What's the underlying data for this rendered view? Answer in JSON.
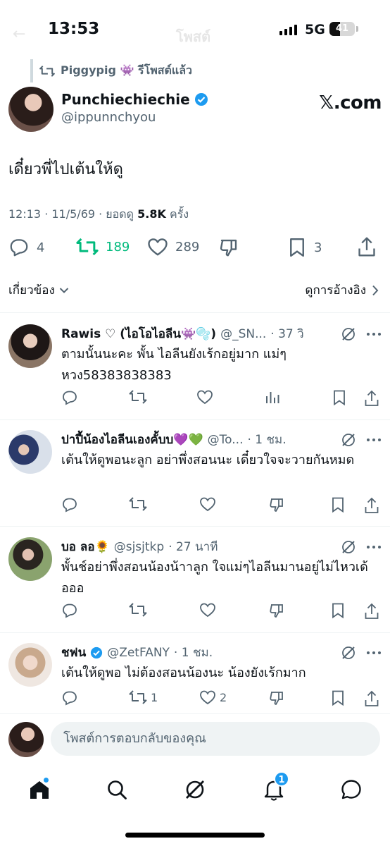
{
  "status": {
    "time": "13:53",
    "network": "5G",
    "battery": "41",
    "battery_fraction": 0.41,
    "faded_title": "โพสต์",
    "faded_back": "←"
  },
  "repost_banner": {
    "text": "Piggypig 👾 รีโพสต์แล้ว"
  },
  "author": {
    "name": "Punchiechiechie",
    "handle": "@ippunnchyou",
    "verified": true,
    "watermark": "𝕏.com"
  },
  "post": {
    "text": "เดี๋ยวพี่ไปเต้นให้ดู",
    "meta_prefix": "12:13 · 11/5/69 · ยอดดู ",
    "views": "5.8K",
    "meta_suffix": " ครั้ง"
  },
  "post_actions": {
    "replies": "4",
    "reposts": "189",
    "likes": "289",
    "bookmarks": "3"
  },
  "sort": {
    "related": "เกี่ยวข้อง",
    "quotes": "ดูการอ้างอิง"
  },
  "replies": [
    {
      "name": "Rawis ♡ (ไอโอไอลีน👾🫧)",
      "handle": "@_SN...",
      "time": "· 37 วิ",
      "text": "ตามนั้นนะคะ พั้น ไอลีนยังเร้กอยู่มาก แม่ๆ หวง58383838383",
      "replies": "",
      "reposts": "",
      "likes": ""
    },
    {
      "name": "ปาปี้น้องไอลีนเองคั้บบ💜💚",
      "handle": "@To...",
      "time": "· 1 ชม.",
      "text": "เต้นให้ดูพอนะลูก อย่าพึ่งสอนนะ เดี๋ยวใจจะวายกันหมด",
      "replies": "",
      "reposts": "",
      "likes": ""
    },
    {
      "name": "บอ ลอ🌻",
      "handle": "@sjsjtkp",
      "time": "· 27 นาที",
      "text": "พั้นช์อย่าพึ่งสอนน้องน้าาลูก ใจแม่ๆไอลีนมานอยู่ไม่ไหวเด้อออ",
      "replies": "",
      "reposts": "",
      "likes": ""
    },
    {
      "name": "ชฟน",
      "handle": "@ZetFANY",
      "time": "· 1 ชม.",
      "verified": true,
      "text": "เต้นให้ดูพอ ไม่ต้องสอนน้องนะ น้องยังเร้กมาก",
      "replies": "",
      "reposts": "1",
      "likes": "2"
    }
  ],
  "composer": {
    "placeholder": "โพสต์การตอบกลับของคุณ"
  },
  "tabbar": {
    "notifications_badge": "1"
  },
  "colors": {
    "accent": "#1d9bf0",
    "repost_green": "#00ba7c",
    "muted": "#536471",
    "text": "#0f1419"
  }
}
